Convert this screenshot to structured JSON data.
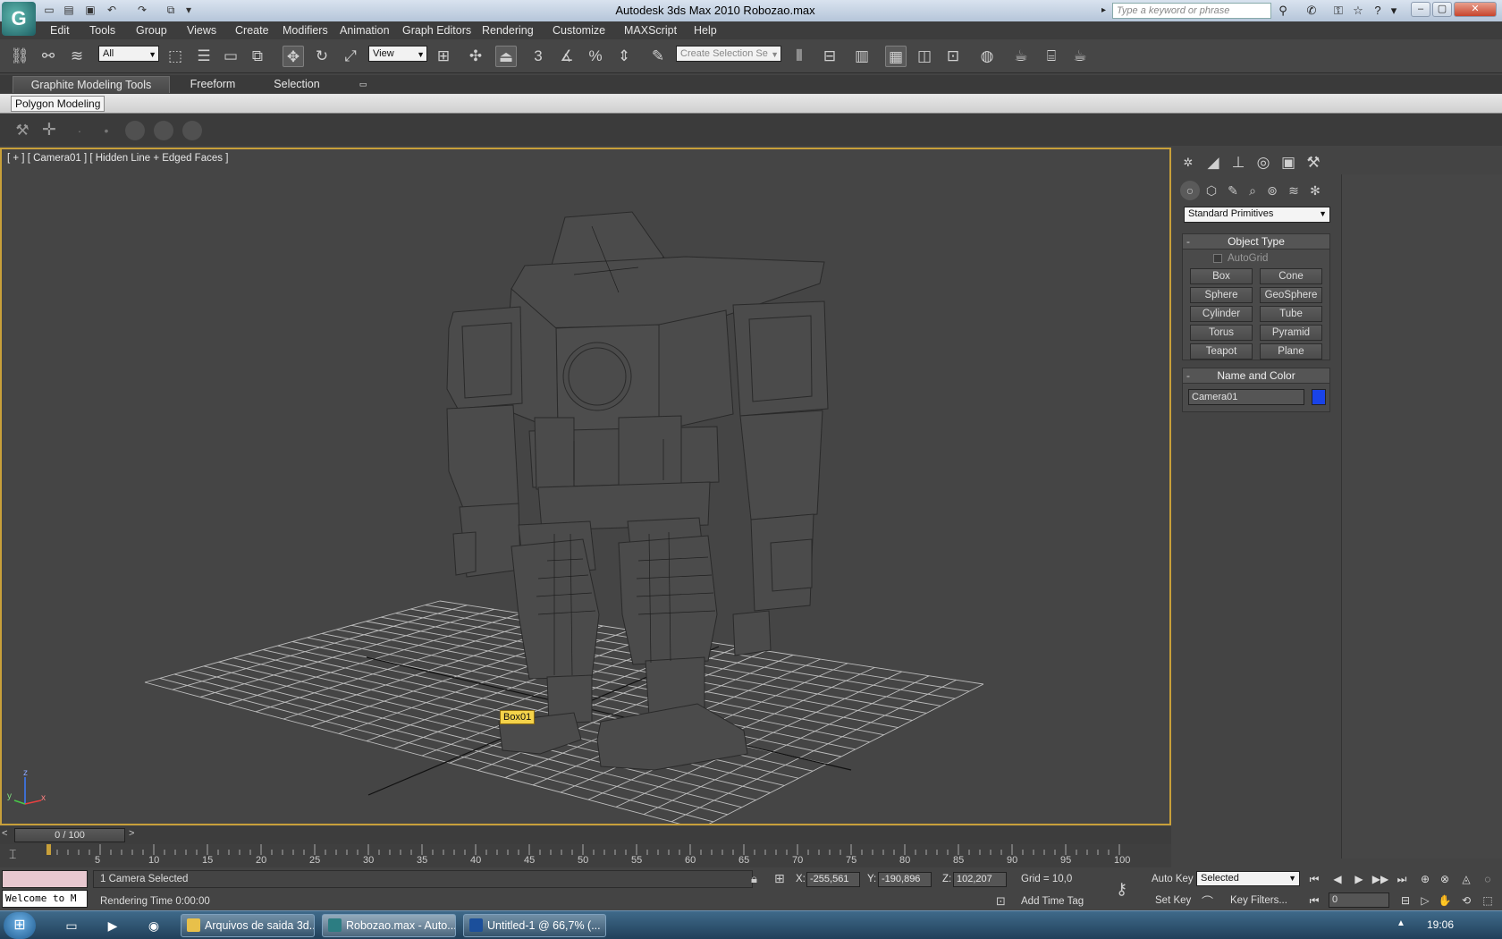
{
  "window": {
    "title": "Autodesk 3ds Max  2010      Robozao.max",
    "search_placeholder": "Type a keyword or phrase"
  },
  "menu": [
    "Edit",
    "Tools",
    "Group",
    "Views",
    "Create",
    "Modifiers",
    "Animation",
    "Graph Editors",
    "Rendering",
    "Customize",
    "MAXScript",
    "Help"
  ],
  "toolbar": {
    "filter_value": "All",
    "ref_coord_value": "View",
    "selection_set_value": "Create Selection Se",
    "snap_label": "3"
  },
  "ribbon": {
    "tabs": [
      "Graphite Modeling Tools",
      "Freeform",
      "Selection"
    ],
    "active_panel": "Polygon Modeling"
  },
  "viewport": {
    "label": "[ + ] [ Camera01 ] [ Hidden Line + Edged Faces ]",
    "object_tag": "Box01",
    "axis_x": "x",
    "axis_y": "y",
    "axis_z": "z"
  },
  "command_panel": {
    "category": "Standard Primitives",
    "object_type_title": "Object Type",
    "autogrid_label": "AutoGrid",
    "buttons": [
      "Box",
      "Cone",
      "Sphere",
      "GeoSphere",
      "Cylinder",
      "Tube",
      "Torus",
      "Pyramid",
      "Teapot",
      "Plane"
    ],
    "name_color_title": "Name and Color",
    "object_name": "Camera01",
    "object_color": "#1943e8"
  },
  "timeline": {
    "slider_label": "0 / 100",
    "ticks": [
      "5",
      "10",
      "15",
      "20",
      "25",
      "30",
      "35",
      "40",
      "45",
      "50",
      "55",
      "60",
      "65",
      "70",
      "75",
      "80",
      "85",
      "90",
      "95",
      "100"
    ]
  },
  "status": {
    "maxscript_listener": "Welcome to M",
    "selection_text": "1 Camera Selected",
    "rendering_time": "Rendering Time  0:00:00",
    "x_label": "X:",
    "x_value": "-255,561",
    "y_label": "Y:",
    "y_value": "-190,896",
    "z_label": "Z:",
    "z_value": "102,207",
    "grid_text": "Grid = 10,0",
    "add_time_tag": "Add Time Tag",
    "auto_key": "Auto Key",
    "set_key": "Set Key",
    "key_mode_value": "Selected",
    "key_filters": "Key Filters...",
    "frame_value": "0"
  },
  "taskbar": {
    "tasks": [
      "Arquivos de saida 3d...",
      "Robozao.max - Auto...",
      "Untitled-1 @ 66,7% (..."
    ],
    "clock": "19:06"
  }
}
